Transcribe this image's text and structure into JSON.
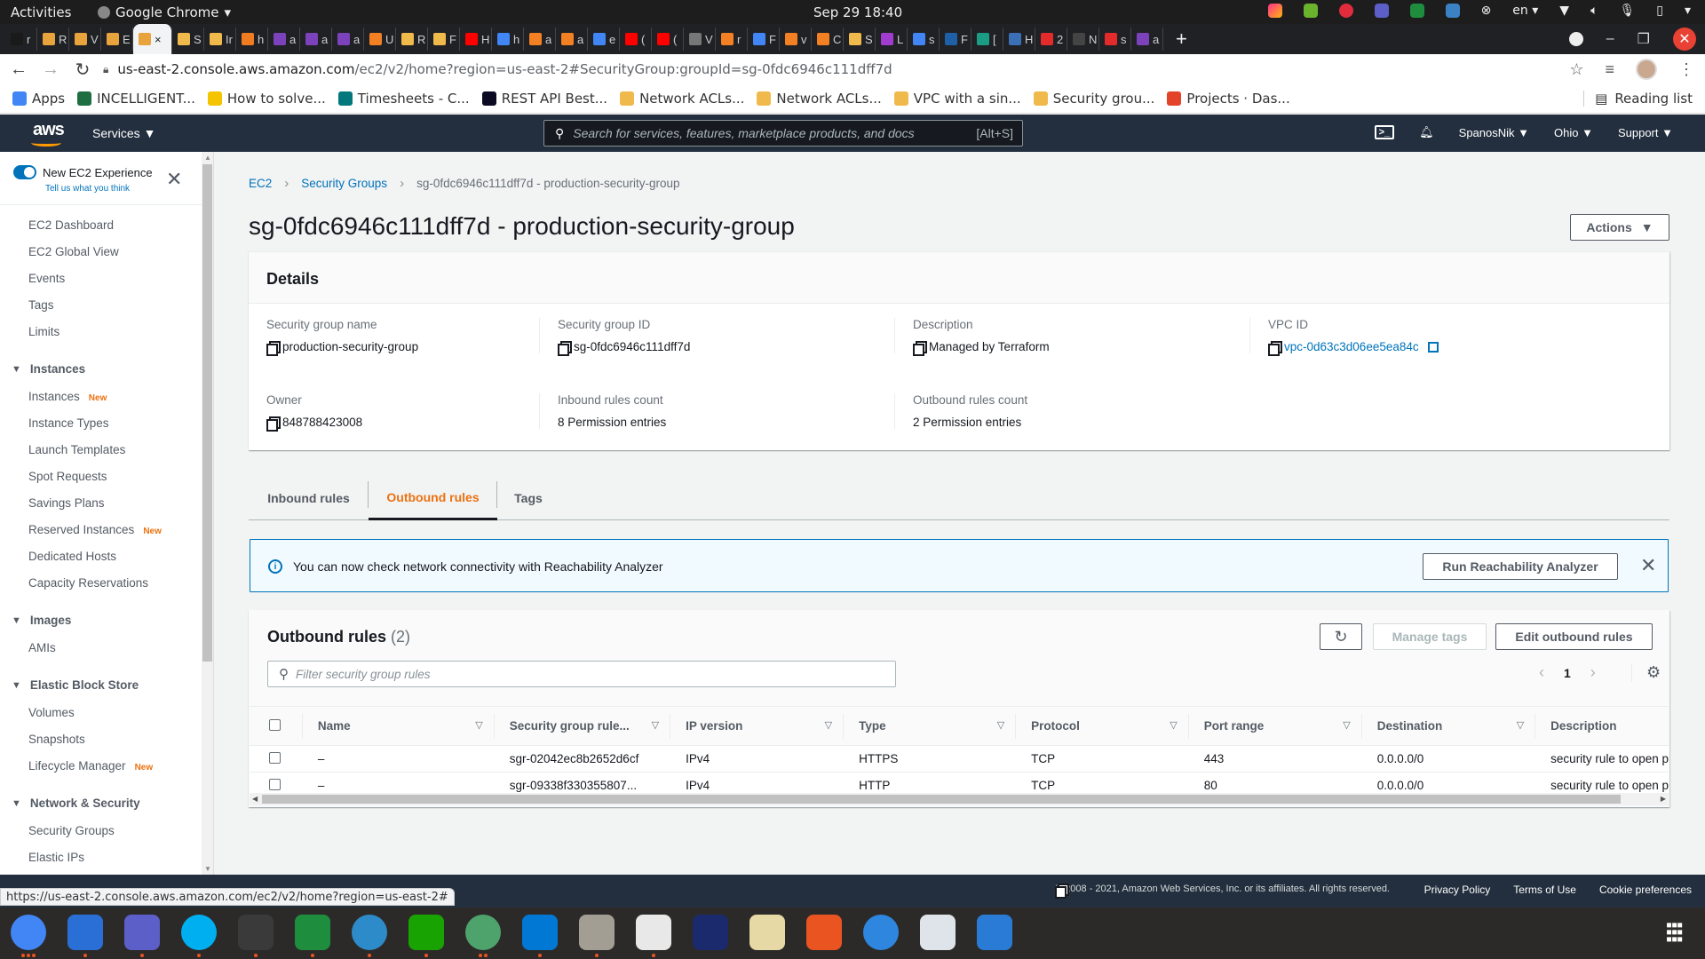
{
  "os": {
    "activities": "Activities",
    "app_name": "Google Chrome",
    "clock": "Sep 29  18:40",
    "input_lang": "en"
  },
  "browser": {
    "tabs": [
      {
        "label": "r",
        "icon": "terraform-icon",
        "color": "#1a1a1a"
      },
      {
        "label": "R",
        "icon": "aws-box-icon",
        "color": "#e8a33d"
      },
      {
        "label": "V",
        "icon": "aws-box-icon",
        "color": "#e8a33d"
      },
      {
        "label": "E",
        "icon": "aws-box-icon",
        "color": "#e8a33d"
      },
      {
        "label": "×",
        "icon": "aws-box-icon",
        "color": "#e8a33d",
        "active": true
      },
      {
        "label": "S",
        "icon": "aws-doc-icon",
        "color": "#f0b94b"
      },
      {
        "label": "Ir",
        "icon": "aws-doc-icon",
        "color": "#f0b94b"
      },
      {
        "label": "h",
        "icon": "orange-cube-icon",
        "color": "#f07c22"
      },
      {
        "label": "a",
        "icon": "terraform-icon",
        "color": "#7b42bc"
      },
      {
        "label": "a",
        "icon": "terraform-icon",
        "color": "#7b42bc"
      },
      {
        "label": "a",
        "icon": "terraform-icon",
        "color": "#7b42bc"
      },
      {
        "label": "U",
        "icon": "stackoverflow-icon",
        "color": "#f48024"
      },
      {
        "label": "R",
        "icon": "aws-doc-icon",
        "color": "#f0b94b"
      },
      {
        "label": "F",
        "icon": "aws-doc-icon",
        "color": "#f0b94b"
      },
      {
        "label": "H",
        "icon": "youtube-icon",
        "color": "#ff0000"
      },
      {
        "label": "h",
        "icon": "google-icon",
        "color": "#4285f4"
      },
      {
        "label": "a",
        "icon": "stackoverflow-icon",
        "color": "#f48024"
      },
      {
        "label": "a",
        "icon": "stackoverflow-icon",
        "color": "#f48024"
      },
      {
        "label": "e",
        "icon": "google-icon",
        "color": "#4285f4"
      },
      {
        "label": "(",
        "icon": "youtube-icon",
        "color": "#ff0000"
      },
      {
        "label": "(",
        "icon": "youtube-icon",
        "color": "#ff0000"
      },
      {
        "label": "V",
        "icon": "bars-icon",
        "color": "#777777"
      },
      {
        "label": "r",
        "icon": "stackoverflow-icon",
        "color": "#f48024"
      },
      {
        "label": "F",
        "icon": "google-icon",
        "color": "#4285f4"
      },
      {
        "label": "v",
        "icon": "stackoverflow-icon",
        "color": "#f48024"
      },
      {
        "label": "C",
        "icon": "stackoverflow-icon",
        "color": "#f48024"
      },
      {
        "label": "S",
        "icon": "aws-doc-icon",
        "color": "#f0b94b"
      },
      {
        "label": "L",
        "icon": "feather-icon",
        "color": "#a03ccf"
      },
      {
        "label": "s",
        "icon": "google-icon",
        "color": "#4285f4"
      },
      {
        "label": "F",
        "icon": "globe-icon",
        "color": "#1f5fa8"
      },
      {
        "label": "[",
        "icon": "gear-badge-icon",
        "color": "#1b9c85"
      },
      {
        "label": "H",
        "icon": "bulb-icon",
        "color": "#3b6fb6"
      },
      {
        "label": "2",
        "icon": "ask-icon",
        "color": "#e42b2b"
      },
      {
        "label": "N",
        "icon": "chrome-icon",
        "color": "#444444"
      },
      {
        "label": "s",
        "icon": "ask-icon",
        "color": "#e42b2b"
      },
      {
        "label": "a",
        "icon": "terraform-icon",
        "color": "#7b42bc"
      }
    ],
    "url_host": "us-east-2.console.aws.amazon.com",
    "url_path": "/ec2/v2/home?region=us-east-2#SecurityGroup:groupId=sg-0fdc6946c111dff7d",
    "bookmarks": [
      {
        "label": "Apps",
        "icon": "apps-grid-icon",
        "color": "#4285f4"
      },
      {
        "label": "INCELLIGENT...",
        "icon": "excel-icon",
        "color": "#1d6f42"
      },
      {
        "label": "How to solve...",
        "icon": "k-icon",
        "color": "#f5c400"
      },
      {
        "label": "Timesheets - C...",
        "icon": "sharepoint-icon",
        "color": "#03787c"
      },
      {
        "label": "REST API Best...",
        "icon": "freecodecamp-icon",
        "color": "#0a0a23"
      },
      {
        "label": "Network ACLs...",
        "icon": "aws-doc-icon",
        "color": "#f0b94b"
      },
      {
        "label": "Network ACLs...",
        "icon": "aws-doc-icon",
        "color": "#f0b94b"
      },
      {
        "label": "VPC with a sin...",
        "icon": "aws-doc-icon",
        "color": "#f0b94b"
      },
      {
        "label": "Security grou...",
        "icon": "aws-doc-icon",
        "color": "#f0b94b"
      },
      {
        "label": "Projects · Das...",
        "icon": "gitlab-icon",
        "color": "#e24329"
      }
    ],
    "reading_list": "Reading list",
    "status_url": "https://us-east-2.console.aws.amazon.com/ec2/v2/home?region=us-east-2#"
  },
  "aws_header": {
    "logo": "aws",
    "services": "Services",
    "search_placeholder": "Search for services, features, marketplace products, and docs",
    "search_shortcut": "[Alt+S]",
    "user": "SpanosNik",
    "region": "Ohio",
    "support": "Support"
  },
  "sidebar": {
    "toggle_label": "New EC2 Experience",
    "toggle_on": true,
    "feedback_link": "Tell us what you think",
    "top_items": [
      "EC2 Dashboard",
      "EC2 Global View",
      "Events",
      "Tags",
      "Limits"
    ],
    "sections": [
      {
        "title": "Instances",
        "items": [
          {
            "label": "Instances",
            "badge": "New"
          },
          {
            "label": "Instance Types"
          },
          {
            "label": "Launch Templates"
          },
          {
            "label": "Spot Requests"
          },
          {
            "label": "Savings Plans"
          },
          {
            "label": "Reserved Instances",
            "badge": "New"
          },
          {
            "label": "Dedicated Hosts"
          },
          {
            "label": "Capacity Reservations"
          }
        ]
      },
      {
        "title": "Images",
        "items": [
          {
            "label": "AMIs"
          }
        ]
      },
      {
        "title": "Elastic Block Store",
        "items": [
          {
            "label": "Volumes"
          },
          {
            "label": "Snapshots"
          },
          {
            "label": "Lifecycle Manager",
            "badge": "New"
          }
        ]
      },
      {
        "title": "Network & Security",
        "items": [
          {
            "label": "Security Groups"
          },
          {
            "label": "Elastic IPs"
          }
        ]
      }
    ]
  },
  "breadcrumb": [
    "EC2",
    "Security Groups",
    "sg-0fdc6946c111dff7d - production-security-group"
  ],
  "page_title": "sg-0fdc6946c111dff7d - production-security-group",
  "actions_label": "Actions",
  "details": {
    "heading": "Details",
    "fields": [
      {
        "key": "Security group name",
        "value": "production-security-group",
        "copy": true
      },
      {
        "key": "Security group ID",
        "value": "sg-0fdc6946c111dff7d",
        "copy": true
      },
      {
        "key": "Description",
        "value": "Managed by Terraform",
        "copy": true
      },
      {
        "key": "VPC ID",
        "value": "vpc-0d63c3d06ee5ea84c",
        "copy": true,
        "link": true
      },
      {
        "key": "Owner",
        "value": "848788423008",
        "copy": true
      },
      {
        "key": "Inbound rules count",
        "value": "8 Permission entries"
      },
      {
        "key": "Outbound rules count",
        "value": "2 Permission entries"
      }
    ]
  },
  "tabs": [
    {
      "label": "Inbound rules"
    },
    {
      "label": "Outbound rules",
      "active": true
    },
    {
      "label": "Tags"
    }
  ],
  "flash": {
    "message": "You can now check network connectivity with Reachability Analyzer",
    "button": "Run Reachability Analyzer"
  },
  "rules": {
    "title": "Outbound rules",
    "count": "(2)",
    "manage_tags": "Manage tags",
    "edit": "Edit outbound rules",
    "filter_placeholder": "Filter security group rules",
    "page": "1",
    "columns": [
      "Name",
      "Security group rule...",
      "IP version",
      "Type",
      "Protocol",
      "Port range",
      "Destination",
      "Description"
    ],
    "rows": [
      [
        "–",
        "sgr-02042ec8b2652d6cf",
        "IPv4",
        "HTTPS",
        "TCP",
        "443",
        "0.0.0.0/0",
        "security rule to open p"
      ],
      [
        "–",
        "sgr-09338f330355807...",
        "IPv4",
        "HTTP",
        "TCP",
        "80",
        "0.0.0.0/0",
        "security rule to open p"
      ]
    ]
  },
  "footer": {
    "copyright": "© 2008 - 2021, Amazon Web Services, Inc. or its affiliates. All rights reserved.",
    "links": [
      "Privacy Policy",
      "Terms of Use",
      "Cookie preferences"
    ]
  },
  "dock": [
    {
      "name": "chrome",
      "color": "#4285f4",
      "dots": 3
    },
    {
      "name": "thunderbird",
      "color": "#2a6fd6",
      "dots": 1
    },
    {
      "name": "teams",
      "color": "#5b5fc7",
      "dots": 1
    },
    {
      "name": "skype",
      "color": "#00aff0",
      "dots": 1
    },
    {
      "name": "terminal",
      "color": "#3a3a3a",
      "dots": 1
    },
    {
      "name": "vpn-shield",
      "color": "#1e8e3e",
      "dots": 1
    },
    {
      "name": "remote-desktop",
      "color": "#2e8bc9",
      "dots": 1
    },
    {
      "name": "libreoffice-calc",
      "color": "#18a303",
      "dots": 1
    },
    {
      "name": "atom",
      "color": "#4ea36c",
      "dots": 2
    },
    {
      "name": "vscode",
      "color": "#0078d4",
      "dots": 1
    },
    {
      "name": "files",
      "color": "#a39e93",
      "dots": 1
    },
    {
      "name": "text-editor",
      "color": "#e8e8e8",
      "dots": 1
    },
    {
      "name": "intellij",
      "color": "#1a2a6c",
      "dots": 0
    },
    {
      "name": "rhythmbox",
      "color": "#e6d9a5",
      "dots": 0
    },
    {
      "name": "software-center",
      "color": "#e95420",
      "dots": 0
    },
    {
      "name": "help",
      "color": "#2e86de",
      "dots": 0
    },
    {
      "name": "virtualbox",
      "color": "#dfe4ea",
      "dots": 0
    },
    {
      "name": "libreoffice-impress",
      "color": "#2a7bd5",
      "dots": 0
    }
  ]
}
